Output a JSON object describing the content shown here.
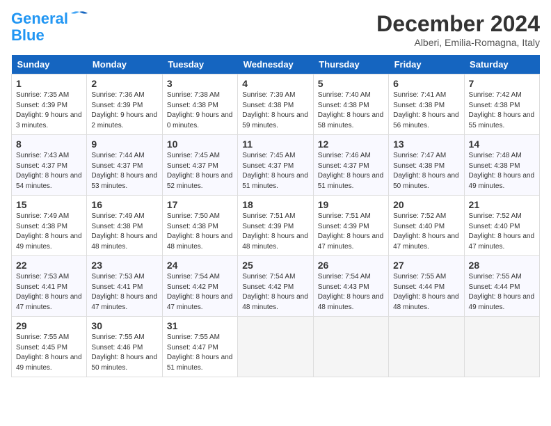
{
  "logo": {
    "line1": "General",
    "line2": "Blue"
  },
  "title": "December 2024",
  "location": "Alberi, Emilia-Romagna, Italy",
  "days_of_week": [
    "Sunday",
    "Monday",
    "Tuesday",
    "Wednesday",
    "Thursday",
    "Friday",
    "Saturday"
  ],
  "weeks": [
    [
      {
        "day": "1",
        "sunrise": "7:35 AM",
        "sunset": "4:39 PM",
        "daylight": "9 hours and 3 minutes."
      },
      {
        "day": "2",
        "sunrise": "7:36 AM",
        "sunset": "4:39 PM",
        "daylight": "9 hours and 2 minutes."
      },
      {
        "day": "3",
        "sunrise": "7:38 AM",
        "sunset": "4:38 PM",
        "daylight": "9 hours and 0 minutes."
      },
      {
        "day": "4",
        "sunrise": "7:39 AM",
        "sunset": "4:38 PM",
        "daylight": "8 hours and 59 minutes."
      },
      {
        "day": "5",
        "sunrise": "7:40 AM",
        "sunset": "4:38 PM",
        "daylight": "8 hours and 58 minutes."
      },
      {
        "day": "6",
        "sunrise": "7:41 AM",
        "sunset": "4:38 PM",
        "daylight": "8 hours and 56 minutes."
      },
      {
        "day": "7",
        "sunrise": "7:42 AM",
        "sunset": "4:38 PM",
        "daylight": "8 hours and 55 minutes."
      }
    ],
    [
      {
        "day": "8",
        "sunrise": "7:43 AM",
        "sunset": "4:37 PM",
        "daylight": "8 hours and 54 minutes."
      },
      {
        "day": "9",
        "sunrise": "7:44 AM",
        "sunset": "4:37 PM",
        "daylight": "8 hours and 53 minutes."
      },
      {
        "day": "10",
        "sunrise": "7:45 AM",
        "sunset": "4:37 PM",
        "daylight": "8 hours and 52 minutes."
      },
      {
        "day": "11",
        "sunrise": "7:45 AM",
        "sunset": "4:37 PM",
        "daylight": "8 hours and 51 minutes."
      },
      {
        "day": "12",
        "sunrise": "7:46 AM",
        "sunset": "4:37 PM",
        "daylight": "8 hours and 51 minutes."
      },
      {
        "day": "13",
        "sunrise": "7:47 AM",
        "sunset": "4:38 PM",
        "daylight": "8 hours and 50 minutes."
      },
      {
        "day": "14",
        "sunrise": "7:48 AM",
        "sunset": "4:38 PM",
        "daylight": "8 hours and 49 minutes."
      }
    ],
    [
      {
        "day": "15",
        "sunrise": "7:49 AM",
        "sunset": "4:38 PM",
        "daylight": "8 hours and 49 minutes."
      },
      {
        "day": "16",
        "sunrise": "7:49 AM",
        "sunset": "4:38 PM",
        "daylight": "8 hours and 48 minutes."
      },
      {
        "day": "17",
        "sunrise": "7:50 AM",
        "sunset": "4:38 PM",
        "daylight": "8 hours and 48 minutes."
      },
      {
        "day": "18",
        "sunrise": "7:51 AM",
        "sunset": "4:39 PM",
        "daylight": "8 hours and 48 minutes."
      },
      {
        "day": "19",
        "sunrise": "7:51 AM",
        "sunset": "4:39 PM",
        "daylight": "8 hours and 47 minutes."
      },
      {
        "day": "20",
        "sunrise": "7:52 AM",
        "sunset": "4:40 PM",
        "daylight": "8 hours and 47 minutes."
      },
      {
        "day": "21",
        "sunrise": "7:52 AM",
        "sunset": "4:40 PM",
        "daylight": "8 hours and 47 minutes."
      }
    ],
    [
      {
        "day": "22",
        "sunrise": "7:53 AM",
        "sunset": "4:41 PM",
        "daylight": "8 hours and 47 minutes."
      },
      {
        "day": "23",
        "sunrise": "7:53 AM",
        "sunset": "4:41 PM",
        "daylight": "8 hours and 47 minutes."
      },
      {
        "day": "24",
        "sunrise": "7:54 AM",
        "sunset": "4:42 PM",
        "daylight": "8 hours and 47 minutes."
      },
      {
        "day": "25",
        "sunrise": "7:54 AM",
        "sunset": "4:42 PM",
        "daylight": "8 hours and 48 minutes."
      },
      {
        "day": "26",
        "sunrise": "7:54 AM",
        "sunset": "4:43 PM",
        "daylight": "8 hours and 48 minutes."
      },
      {
        "day": "27",
        "sunrise": "7:55 AM",
        "sunset": "4:44 PM",
        "daylight": "8 hours and 48 minutes."
      },
      {
        "day": "28",
        "sunrise": "7:55 AM",
        "sunset": "4:44 PM",
        "daylight": "8 hours and 49 minutes."
      }
    ],
    [
      {
        "day": "29",
        "sunrise": "7:55 AM",
        "sunset": "4:45 PM",
        "daylight": "8 hours and 49 minutes."
      },
      {
        "day": "30",
        "sunrise": "7:55 AM",
        "sunset": "4:46 PM",
        "daylight": "8 hours and 50 minutes."
      },
      {
        "day": "31",
        "sunrise": "7:55 AM",
        "sunset": "4:47 PM",
        "daylight": "8 hours and 51 minutes."
      },
      null,
      null,
      null,
      null
    ]
  ]
}
